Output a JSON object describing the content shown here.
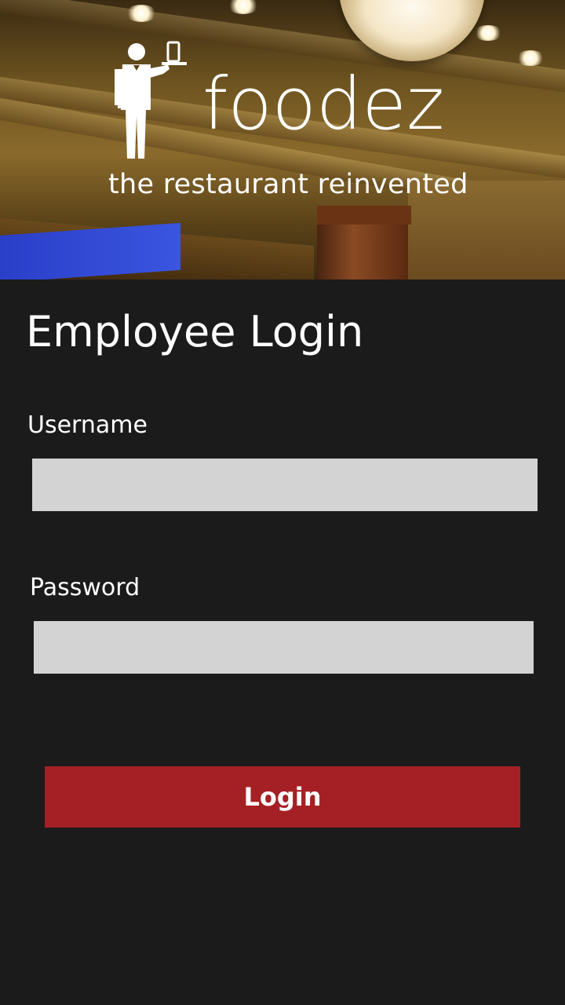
{
  "header": {
    "brand_name": "foodez",
    "tagline": "the restaurant reinvented",
    "logo_icon": "waiter-with-tray-icon",
    "background": "restaurant-ceiling-photo"
  },
  "login": {
    "title": "Employee Login",
    "username_label": "Username",
    "username_value": "",
    "password_label": "Password",
    "password_value": "",
    "submit_label": "Login"
  },
  "colors": {
    "page_background": "#1b1b1b",
    "input_background": "#d3d3d3",
    "button_background": "#a52024",
    "text": "#ffffff"
  }
}
